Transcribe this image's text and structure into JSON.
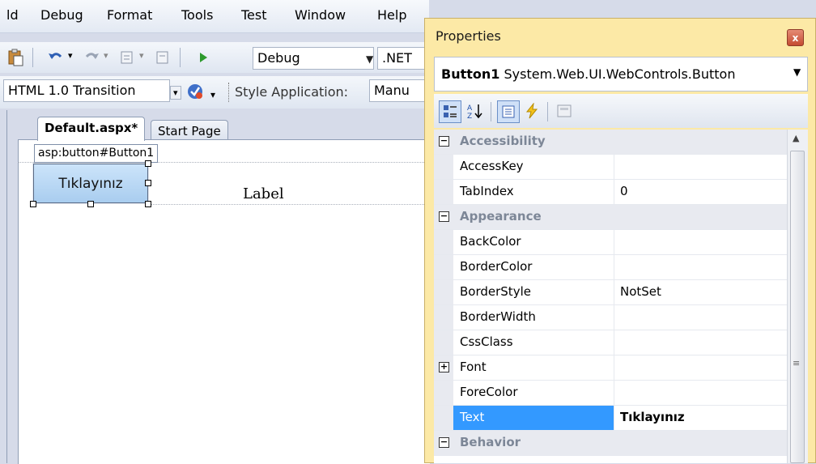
{
  "menu": [
    "ld",
    "Debug",
    "Format",
    "Tools",
    "Test",
    "Window",
    "Help"
  ],
  "toolbar1": {
    "config_value": "Debug",
    "platform_value": ".NET"
  },
  "toolbar2": {
    "doctype_value": "HTML 1.0 Transition",
    "style_app_label": "Style Application:",
    "style_app_value": "Manu"
  },
  "editor": {
    "tabs": [
      {
        "label": "Default.aspx*",
        "active": true
      },
      {
        "label": "Start Page",
        "active": false
      }
    ],
    "selected_tag": "asp:button#Button1",
    "button_text": "Tıklayınız",
    "label_text": "Label"
  },
  "properties": {
    "title": "Properties",
    "close_glyph": "x",
    "object_name": "Button1",
    "object_type": "System.Web.UI.WebControls.Button",
    "rows": [
      {
        "kind": "category",
        "name": "Accessibility",
        "expander": "⊟"
      },
      {
        "kind": "prop",
        "name": "AccessKey",
        "value": ""
      },
      {
        "kind": "prop",
        "name": "TabIndex",
        "value": "0"
      },
      {
        "kind": "category",
        "name": "Appearance",
        "expander": "⊟"
      },
      {
        "kind": "prop",
        "name": "BackColor",
        "value": ""
      },
      {
        "kind": "prop",
        "name": "BorderColor",
        "value": ""
      },
      {
        "kind": "prop",
        "name": "BorderStyle",
        "value": "NotSet"
      },
      {
        "kind": "prop",
        "name": "BorderWidth",
        "value": ""
      },
      {
        "kind": "prop",
        "name": "CssClass",
        "value": ""
      },
      {
        "kind": "prop",
        "name": "Font",
        "value": "",
        "expander": "⊞"
      },
      {
        "kind": "prop",
        "name": "ForeColor",
        "value": ""
      },
      {
        "kind": "prop",
        "name": "Text",
        "value": "Tıklayınız",
        "selected": true
      },
      {
        "kind": "category",
        "name": "Behavior",
        "expander": "⊟"
      }
    ]
  },
  "colors": {
    "selection": "#3399ff",
    "props_frame": "#fce9a6",
    "category_text": "#7d8797"
  }
}
